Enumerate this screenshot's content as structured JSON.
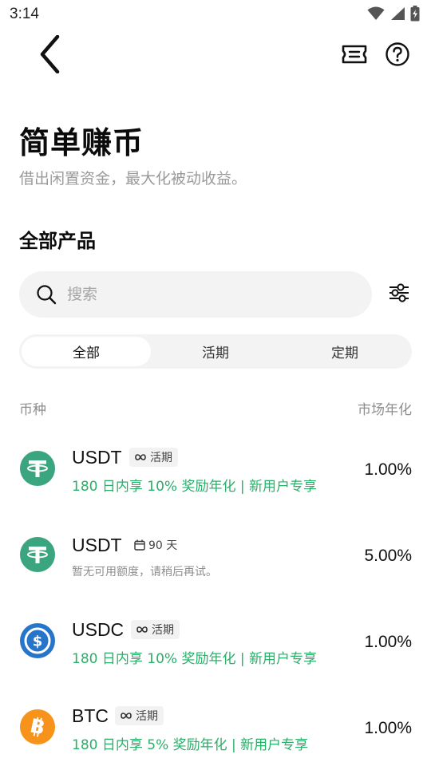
{
  "status_bar": {
    "time": "3:14",
    "icons": [
      "wifi-icon",
      "signal-icon",
      "battery-charging-icon"
    ]
  },
  "nav": {
    "back_icon": "chevron-left-icon",
    "ticket_icon": "ticket-icon",
    "help_icon": "question-circle-icon"
  },
  "header": {
    "title": "简单赚币",
    "subtitle": "借出闲置资金，最大化被动收益。"
  },
  "section": {
    "title": "全部产品"
  },
  "search": {
    "placeholder": "搜索",
    "value": ""
  },
  "tabs": [
    {
      "label": "全部",
      "active": true
    },
    {
      "label": "活期",
      "active": false
    },
    {
      "label": "定期",
      "active": false
    }
  ],
  "columns": {
    "left": "币种",
    "right": "市场年化"
  },
  "colors": {
    "accent_green": "#27b068",
    "usdt": "#3aa57e",
    "usdc": "#2775ca",
    "btc": "#f7931a"
  },
  "products": [
    {
      "name": "USDT",
      "coin_icon": "tether-icon",
      "tag_icon": "infinity-icon",
      "tag": "活期",
      "promo": "180 日内享 10% 奖励年化 | 新用户专享",
      "note": "",
      "apy": "1.00%"
    },
    {
      "name": "USDT",
      "coin_icon": "tether-icon",
      "tag_icon": "calendar-icon",
      "tag": "90 天",
      "promo": "",
      "note": "暂无可用额度，请稍后再试。",
      "apy": "5.00%"
    },
    {
      "name": "USDC",
      "coin_icon": "usdc-icon",
      "tag_icon": "infinity-icon",
      "tag": "活期",
      "promo": "180 日内享 10% 奖励年化 | 新用户专享",
      "note": "",
      "apy": "1.00%"
    },
    {
      "name": "BTC",
      "coin_icon": "bitcoin-icon",
      "tag_icon": "infinity-icon",
      "tag": "活期",
      "promo": "180 日内享 5% 奖励年化 | 新用户专享",
      "note": "",
      "apy": "1.00%"
    }
  ]
}
